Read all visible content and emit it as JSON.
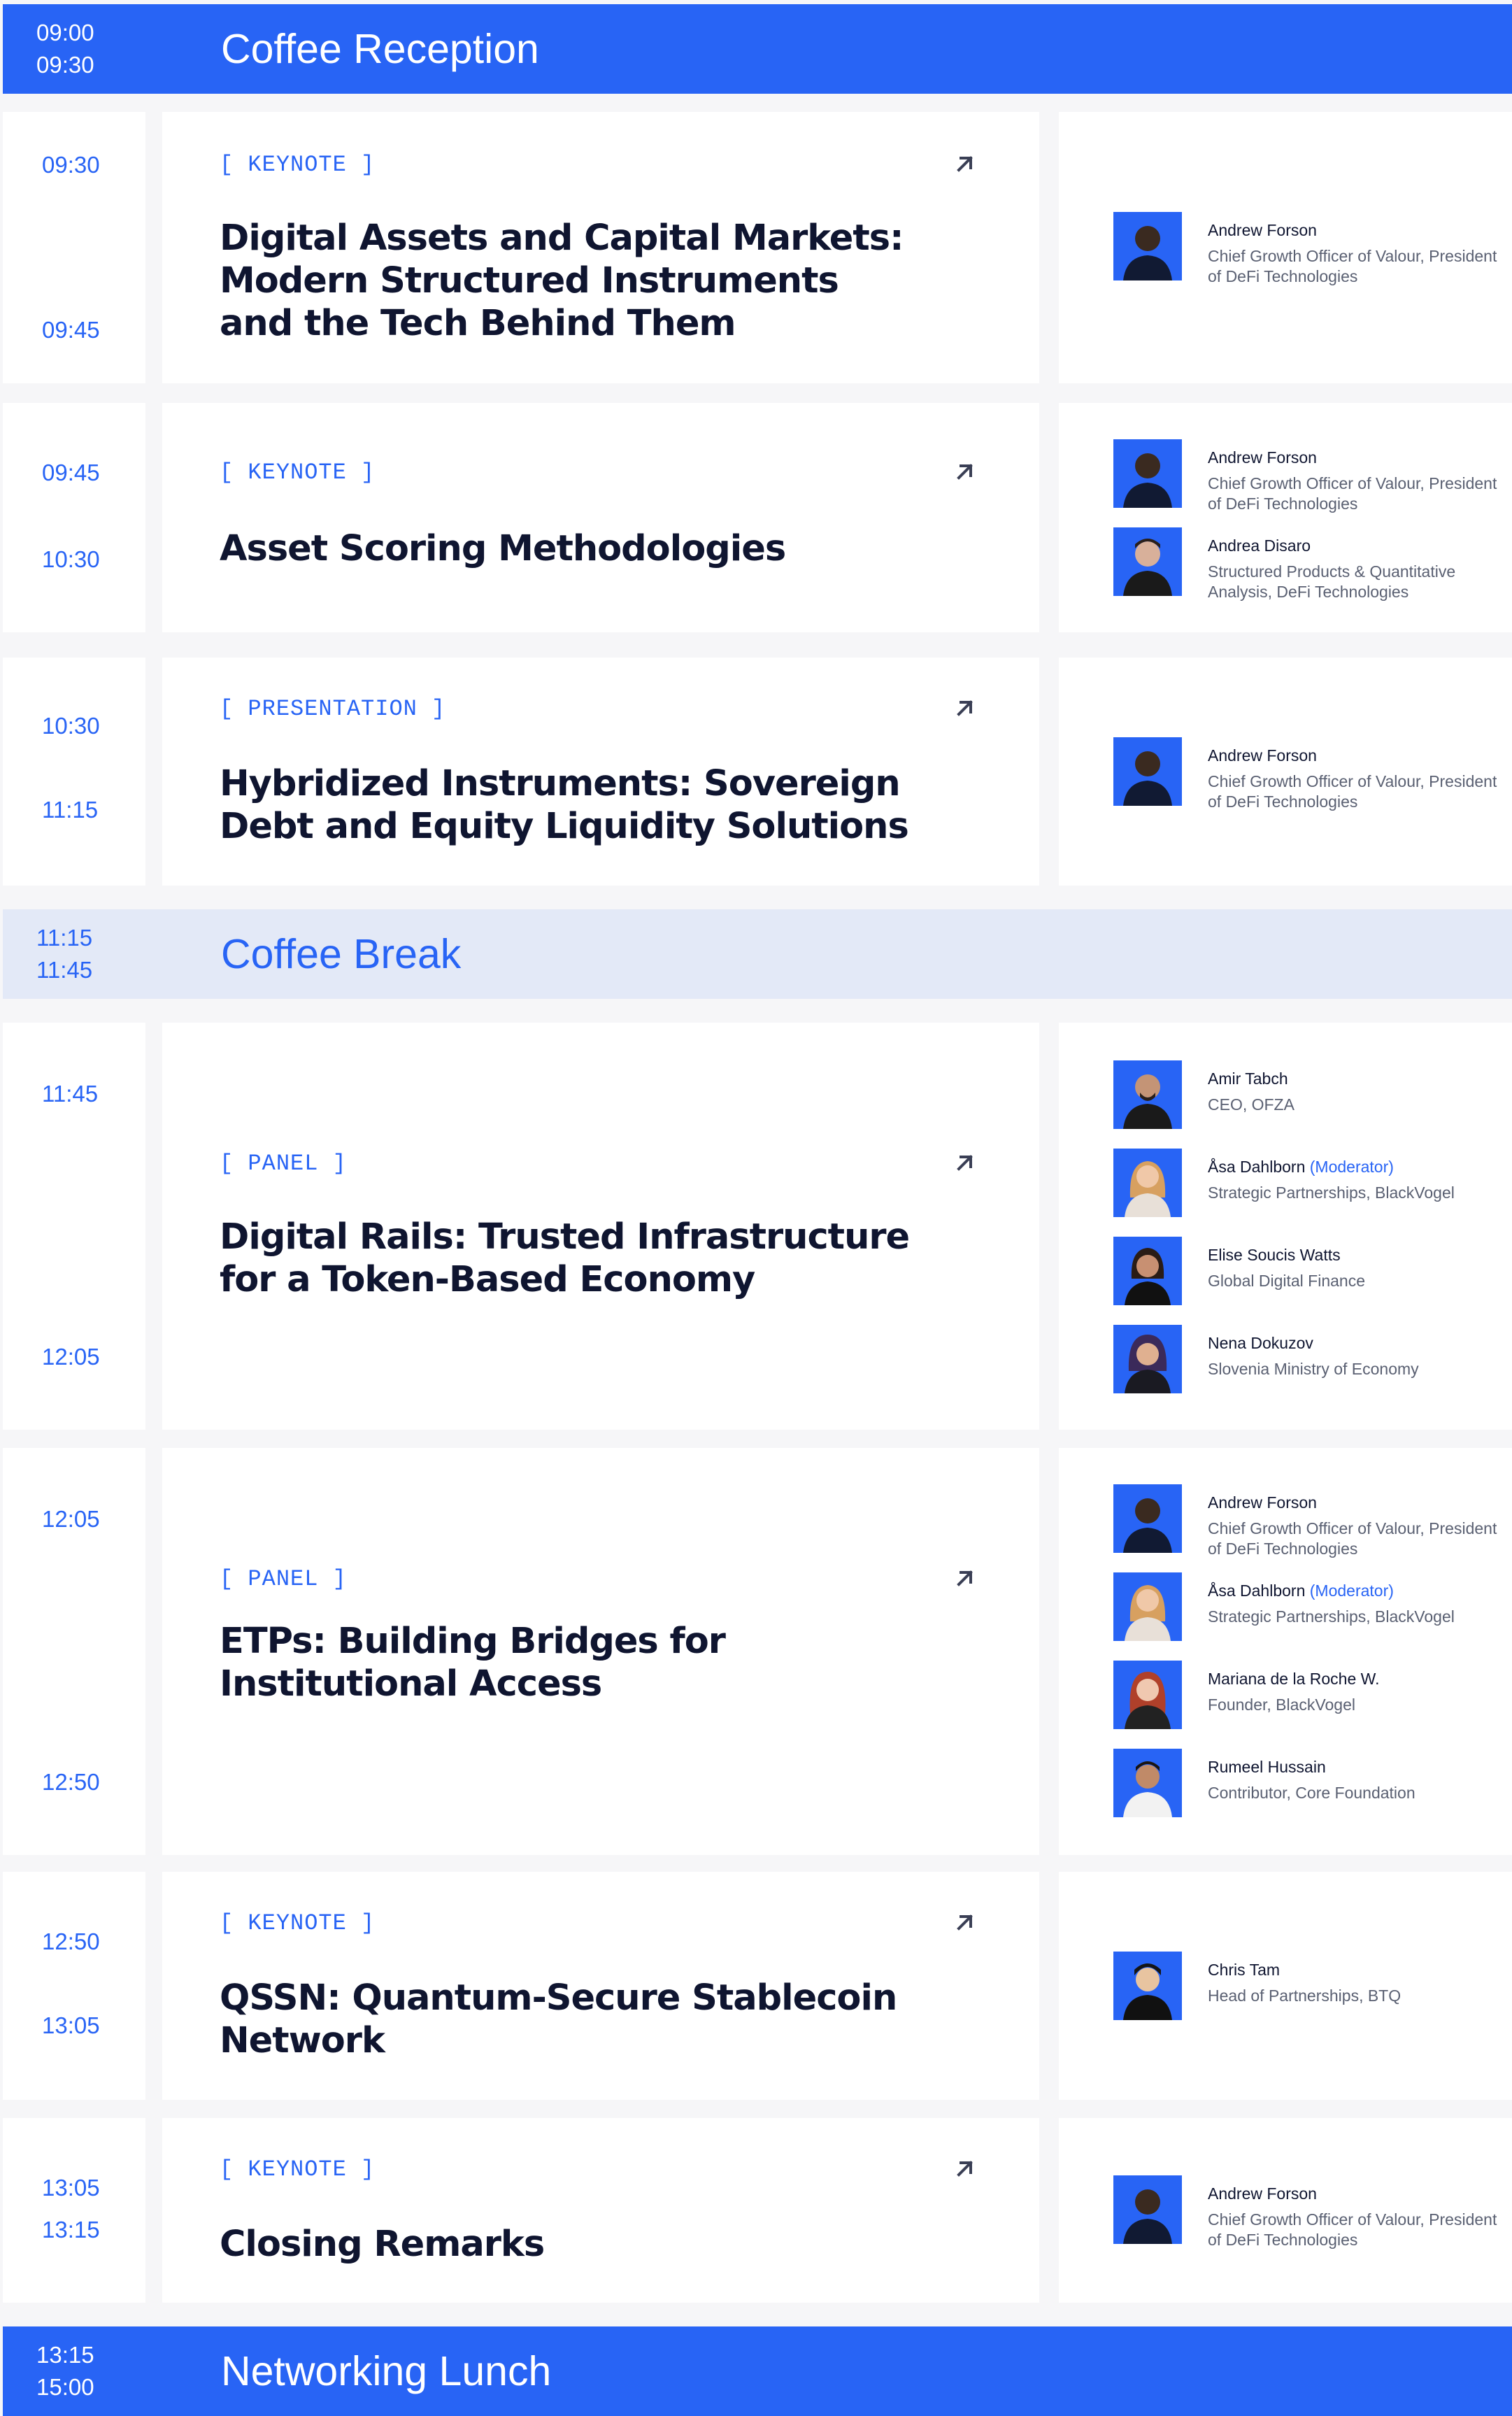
{
  "bands": [
    {
      "start": "09:00",
      "end": "09:30",
      "title": "Coffee Reception"
    },
    {
      "start": "11:15",
      "end": "11:45",
      "title": "Coffee Break"
    },
    {
      "start": "13:15",
      "end": "15:00",
      "title": "Networking Lunch"
    }
  ],
  "sessions": [
    {
      "start": "09:30",
      "end": "09:45",
      "type": "[ KEYNOTE ]",
      "title": "Digital Assets and Capital Markets: Modern Structured Instruments and the Tech Behind Them",
      "speakers": [
        {
          "name": "Andrew Forson",
          "role": "Chief Growth Officer of Valour, President of DeFi Technologies"
        }
      ]
    },
    {
      "start": "09:45",
      "end": "10:30",
      "type": "[ KEYNOTE ]",
      "title": "Asset Scoring Methodologies",
      "speakers": [
        {
          "name": "Andrew Forson",
          "role": "Chief Growth Officer of Valour, President of DeFi Technologies"
        },
        {
          "name": "Andrea Disaro",
          "role": "Structured Products & Quantitative Analysis, DeFi Technologies"
        }
      ]
    },
    {
      "start": "10:30",
      "end": "11:15",
      "type": "[ PRESENTATION ]",
      "title": "Hybridized Instruments: Sovereign Debt and Equity Liquidity Solutions",
      "speakers": [
        {
          "name": "Andrew Forson",
          "role": "Chief Growth Officer of Valour, President of DeFi Technologies"
        }
      ]
    },
    {
      "start": "11:45",
      "end": "12:05",
      "type": "[ PANEL ]",
      "title": "Digital Rails: Trusted Infrastructure for a Token-Based Economy",
      "speakers": [
        {
          "name": "Amir Tabch",
          "role": "CEO, OFZA"
        },
        {
          "name": "Åsa Dahlborn",
          "moderator": "(Moderator)",
          "role": "Strategic Partnerships, BlackVogel"
        },
        {
          "name": "Elise Soucis Watts",
          "role": "Global Digital Finance"
        },
        {
          "name": "Nena Dokuzov",
          "role": "Slovenia Ministry of Economy"
        }
      ]
    },
    {
      "start": "12:05",
      "end": "12:50",
      "type": "[ PANEL ]",
      "title": "ETPs: Building Bridges for Institutional Access",
      "speakers": [
        {
          "name": "Andrew Forson",
          "role": "Chief Growth Officer of Valour, President of DeFi Technologies"
        },
        {
          "name": "Åsa Dahlborn",
          "moderator": "(Moderator)",
          "role": "Strategic Partnerships, BlackVogel"
        },
        {
          "name": "Mariana de la Roche W.",
          "role": "Founder, BlackVogel"
        },
        {
          "name": "Rumeel Hussain",
          "role": "Contributor,  Core Foundation"
        }
      ]
    },
    {
      "start": "12:50",
      "end": "13:05",
      "type": "[ KEYNOTE ]",
      "title": "QSSN: Quantum-Secure Stablecoin Network",
      "speakers": [
        {
          "name": "Chris Tam",
          "role": "Head of  Partnerships, BTQ"
        }
      ]
    },
    {
      "start": "13:05",
      "end": "13:15",
      "type": "[ KEYNOTE ]",
      "title": "Closing Remarks",
      "speakers": [
        {
          "name": "Andrew Forson",
          "role": "Chief Growth Officer of Valour, President of DeFi Technologies"
        }
      ]
    }
  ],
  "icons": {
    "session_link": "arrow-up-right-icon",
    "speaker_photo": "person-avatar-icon"
  },
  "colors": {
    "accent": "#2864f5",
    "break_band": "#e3e9f7",
    "title_text": "#0f1530",
    "muted_text": "#5a6072"
  }
}
